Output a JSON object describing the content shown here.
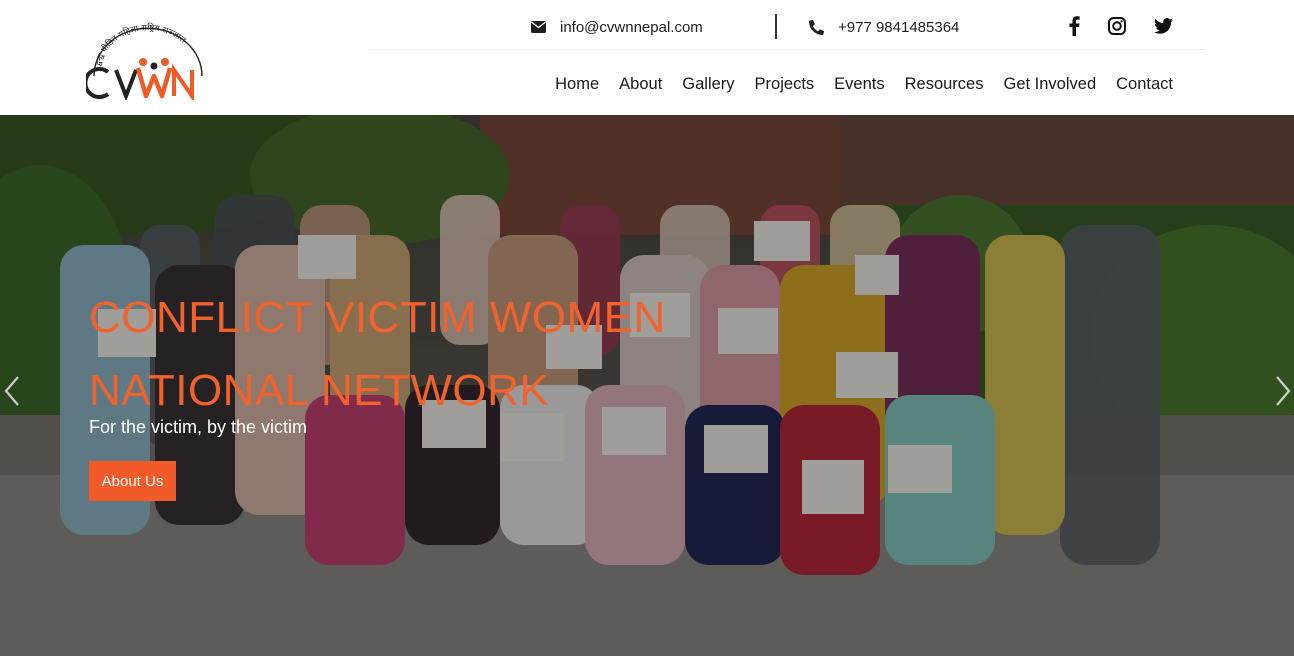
{
  "header": {
    "logo": {
      "text": "CVWN",
      "tagline": "द्वन्द्व पीडित महिला राष्ट्रिय सञ्जाल",
      "accent_color": "#f05a24"
    },
    "contact": {
      "email": "info@cvwnnepal.com",
      "phone": "+977 9841485364",
      "email_icon": "envelope-icon",
      "phone_icon": "phone-icon"
    },
    "social": [
      "facebook-icon",
      "instagram-icon",
      "twitter-icon"
    ],
    "nav": [
      "Home",
      "About",
      "Gallery",
      "Projects",
      "Events",
      "Resources",
      "Get Involved",
      "Contact"
    ]
  },
  "hero": {
    "title_line1": "CONFLICT VICTIM WOMEN",
    "title_line2": "NATIONAL NETWORK",
    "subtitle": "For the victim, by the victim",
    "button_label": "About Us",
    "title_color": "#f2622c",
    "button_color": "#f25a2a"
  }
}
